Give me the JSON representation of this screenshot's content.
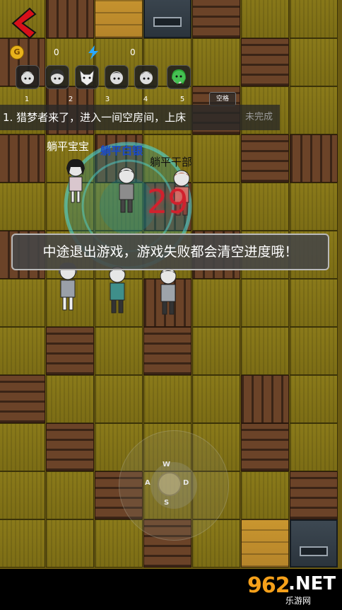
{
  "hud": {
    "coins": "0",
    "energy": "0",
    "coin_symbol": "G",
    "avatars": [
      {
        "icon": "girl-face-icon",
        "num": "1"
      },
      {
        "icon": "girl-face-icon",
        "num": "2"
      },
      {
        "icon": "fox-mask-icon",
        "num": "3"
      },
      {
        "icon": "boy-face-icon",
        "num": "3"
      },
      {
        "icon": "boy-face-icon",
        "num": "4"
      },
      {
        "icon": "ghost-face-icon",
        "num": "5"
      }
    ],
    "space_key": "空格"
  },
  "task": {
    "text": "1. 猎梦者来了，进入一间空房间，上床",
    "status": "未完成"
  },
  "players": [
    {
      "name": "躺平宝宝",
      "style": "white"
    },
    {
      "name": "躺平白银",
      "style": "blue"
    },
    {
      "name": "躺平干部",
      "style": "dark"
    }
  ],
  "countdown": "29",
  "toast": "中途退出游戏，游戏失败都会清空进度哦！",
  "joystick": {
    "up": "W",
    "left": "A",
    "right": "D",
    "down": "S"
  },
  "watermark": {
    "num": "962",
    "dot": ".NET",
    "cn": "乐游网"
  },
  "colors": {
    "countdown": "#d1212d",
    "player_blue": "#1a4ac9",
    "coin": "#e8b21c",
    "energy": "#2aa8ff"
  }
}
